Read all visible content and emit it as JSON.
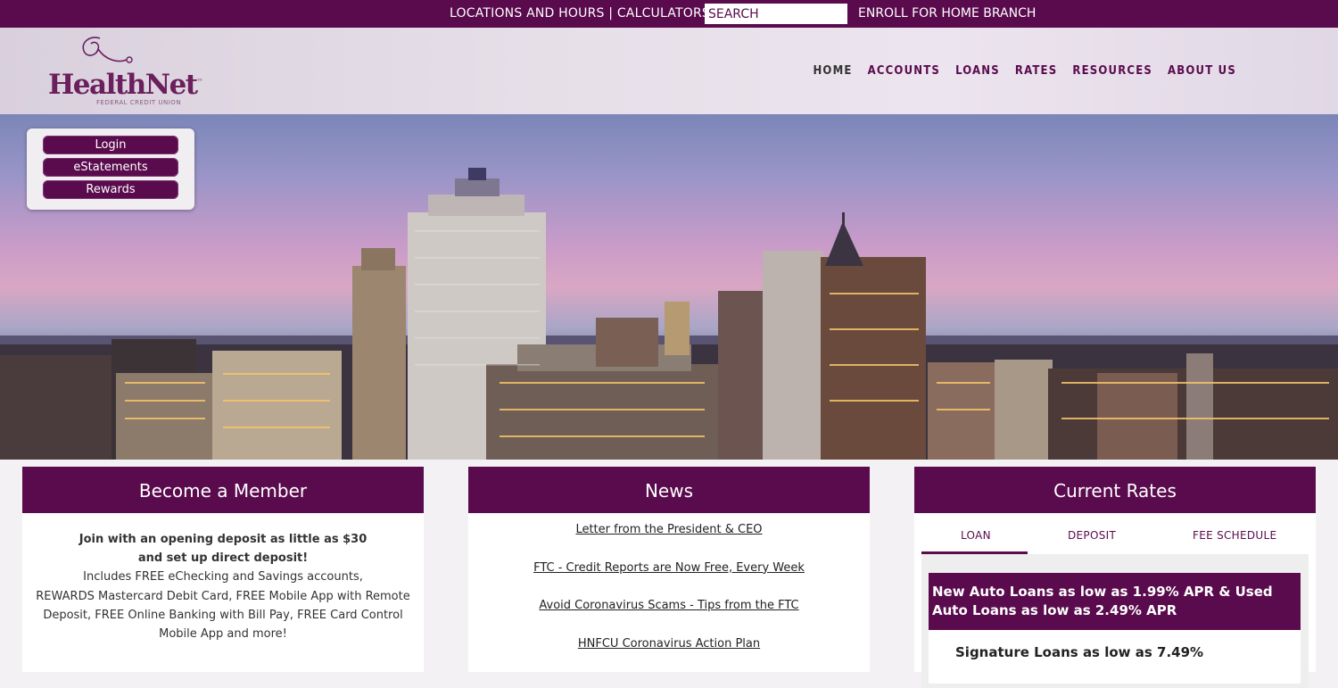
{
  "topbar": {
    "locations": "LOCATIONS AND HOURS",
    "separator": " | ",
    "calculators": "CALCULATORS",
    "search_placeholder": "SEARCH",
    "enroll": "ENROLL FOR HOME BRANCH"
  },
  "logo": {
    "name": "HealthNet",
    "tm": "™",
    "subtitle": "FEDERAL CREDIT UNION"
  },
  "nav": {
    "items": [
      "HOME",
      "ACCOUNTS",
      "LOANS",
      "RATES",
      "RESOURCES",
      "ABOUT US"
    ]
  },
  "login_box": {
    "login": "Login",
    "estatements": "eStatements",
    "rewards": "Rewards"
  },
  "member": {
    "title": "Become a Member",
    "line1": "Join with an opening deposit as little as $30",
    "line2": "and set up direct deposit!",
    "line3": "Includes FREE eChecking and Savings accounts,",
    "line4": "REWARDS Mastercard Debit Card, FREE Mobile App with Remote",
    "line5": "Deposit, FREE Online Banking with Bill Pay, FREE Card Control",
    "line6": "Mobile App and more!"
  },
  "news": {
    "title": "News",
    "items": [
      "Letter from the President & CEO",
      "FTC - Credit Reports are Now Free, Every Week",
      "Avoid Coronavirus Scams - Tips from the FTC",
      "HNFCU Coronavirus Action Plan"
    ]
  },
  "rates": {
    "title": "Current Rates",
    "tabs": [
      "LOAN",
      "DEPOSIT",
      "FEE SCHEDULE"
    ],
    "highlight_line1": "New Auto Loans as low as 1.99% APR & Used",
    "highlight_line2": "Auto Loans as low as 2.49% APR",
    "signature": "Signature Loans as low as 7.49%"
  },
  "colors": {
    "brand_purple": "#5a0b4d"
  }
}
